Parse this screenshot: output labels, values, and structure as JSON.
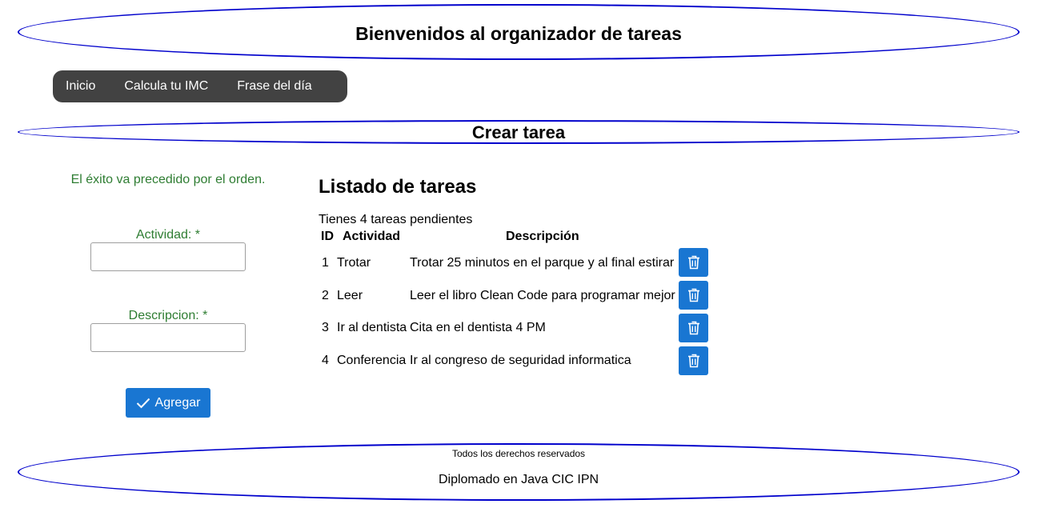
{
  "header": {
    "title": "Bienvenidos al organizador de tareas"
  },
  "nav": {
    "items": [
      "Inicio",
      "Calcula tu IMC",
      "Frase del día"
    ]
  },
  "section": {
    "title": "Crear tarea"
  },
  "form": {
    "quote": "El éxito va precedido por el orden.",
    "activity_label": "Actividad:  *",
    "activity_value": "",
    "description_label": "Descripcion:  *",
    "description_value": "",
    "submit_label": "Agregar",
    "submit_icon": "check-icon"
  },
  "tasks": {
    "title": "Listado de tareas",
    "pending_text": "Tienes 4 tareas pendientes",
    "columns": {
      "id": "ID",
      "activity": "Actividad",
      "description": "Descripción"
    },
    "rows": [
      {
        "id": "1",
        "activity": "Trotar",
        "description": "Trotar 25 minutos en el parque y al final estirar"
      },
      {
        "id": "2",
        "activity": "Leer",
        "description": "Leer el libro Clean Code para programar mejor"
      },
      {
        "id": "3",
        "activity": "Ir al dentista",
        "description": "Cita en el dentista 4 PM"
      },
      {
        "id": "4",
        "activity": "Conferencia",
        "description": "Ir al congreso de seguridad informatica"
      }
    ],
    "delete_icon": "trash-icon"
  },
  "footer": {
    "rights": "Todos los derechos reservados",
    "course": "Diplomado en Java CIC IPN"
  },
  "colors": {
    "border": "#0000cc",
    "nav_bg": "#424242",
    "accent": "#1976d2",
    "quote": "#2e7d32"
  }
}
